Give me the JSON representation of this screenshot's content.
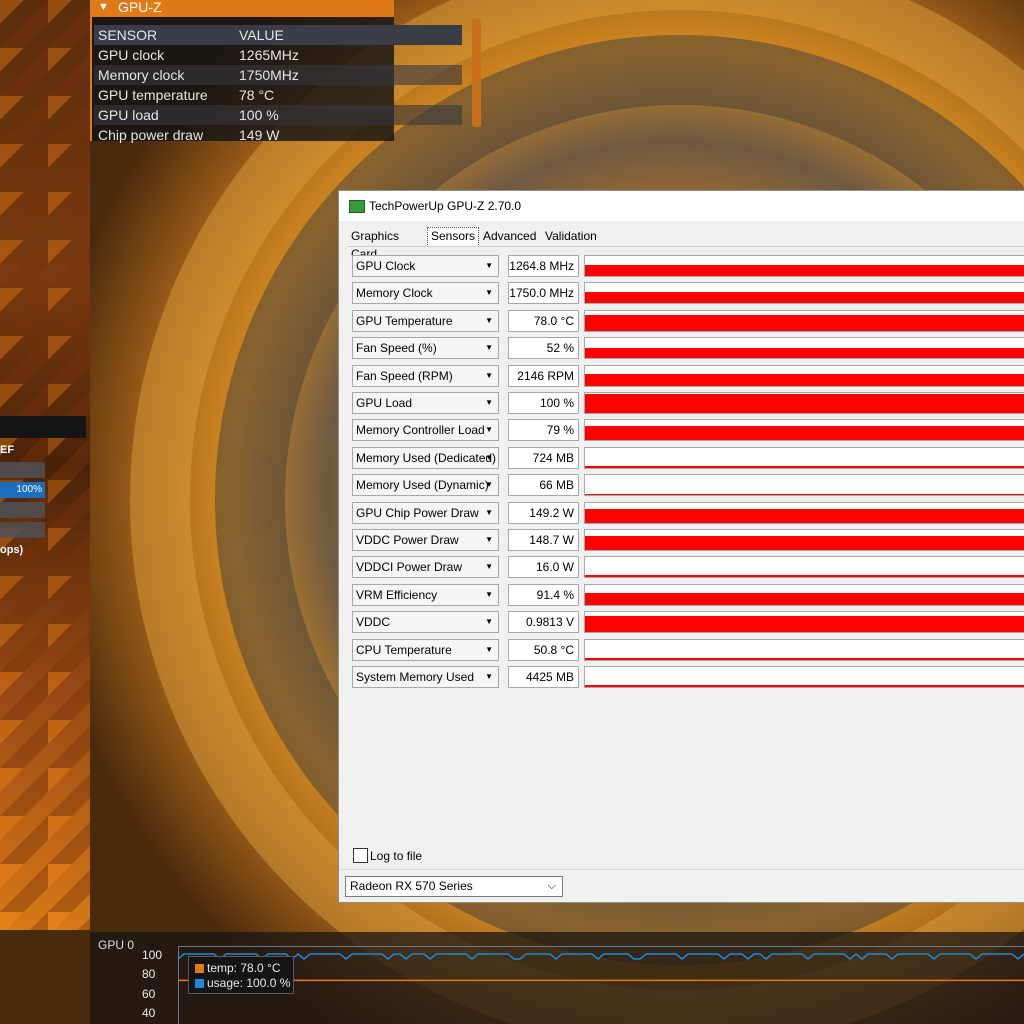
{
  "overlay": {
    "title": "GPU-Z",
    "headers": [
      "SENSOR",
      "VALUE"
    ],
    "rows": [
      [
        "GPU clock",
        "1265MHz"
      ],
      [
        "Memory clock",
        "1750MHz"
      ],
      [
        "GPU temperature",
        "78 °C"
      ],
      [
        "GPU load",
        "100 %"
      ],
      [
        "Chip power draw",
        "149 W"
      ]
    ]
  },
  "left_panel": {
    "label_ef": "EF",
    "bar_value": "100%",
    "label_ops": "ops)"
  },
  "window": {
    "title": "TechPowerUp GPU-Z 2.70.0",
    "tabs": [
      "Graphics Card",
      "Sensors",
      "Advanced",
      "Validation"
    ],
    "selected_tab": "Sensors",
    "sensors": [
      {
        "name": "GPU Clock",
        "value": "1264.8 MHz",
        "level": 0.55
      },
      {
        "name": "Memory Clock",
        "value": "1750.0 MHz",
        "level": 0.55
      },
      {
        "name": "GPU Temperature",
        "value": "78.0 °C",
        "level": 0.78
      },
      {
        "name": "Fan Speed (%)",
        "value": "52 %",
        "level": 0.5
      },
      {
        "name": "Fan Speed (RPM)",
        "value": "2146 RPM",
        "level": 0.6
      },
      {
        "name": "GPU Load",
        "value": "100 %",
        "level": 0.95
      },
      {
        "name": "Memory Controller Load",
        "value": "79 %",
        "level": 0.72
      },
      {
        "name": "Memory Used (Dedicated)",
        "value": "724 MB",
        "level": 0.08
      },
      {
        "name": "Memory Used (Dynamic)",
        "value": "66 MB",
        "level": 0.02
      },
      {
        "name": "GPU Chip Power Draw",
        "value": "149.2 W",
        "level": 0.72
      },
      {
        "name": "VDDC Power Draw",
        "value": "148.7 W",
        "level": 0.72
      },
      {
        "name": "VDDCI Power Draw",
        "value": "16.0 W",
        "level": 0.08
      },
      {
        "name": "VRM Efficiency",
        "value": "91.4 %",
        "level": 0.6
      },
      {
        "name": "VDDC",
        "value": "0.9813 V",
        "level": 0.8
      },
      {
        "name": "CPU Temperature",
        "value": "50.8 °C",
        "level": 0.08
      },
      {
        "name": "System Memory Used",
        "value": "4425 MB",
        "level": 0.08
      }
    ],
    "log_label": "Log to file",
    "gpu_select": "Radeon RX 570 Series"
  },
  "graph": {
    "title": "GPU 0",
    "yticks": [
      "100",
      "80",
      "60",
      "40"
    ],
    "legend": [
      {
        "label": "temp: 78.0 °C",
        "color": "#e07a18"
      },
      {
        "label": "usage: 100.0 %",
        "color": "#1c8ad6"
      }
    ],
    "temp_value": 78,
    "usage_value": 100
  },
  "colors": {
    "graph_red": "#ff0000",
    "overlay_orange": "#e07a18"
  }
}
